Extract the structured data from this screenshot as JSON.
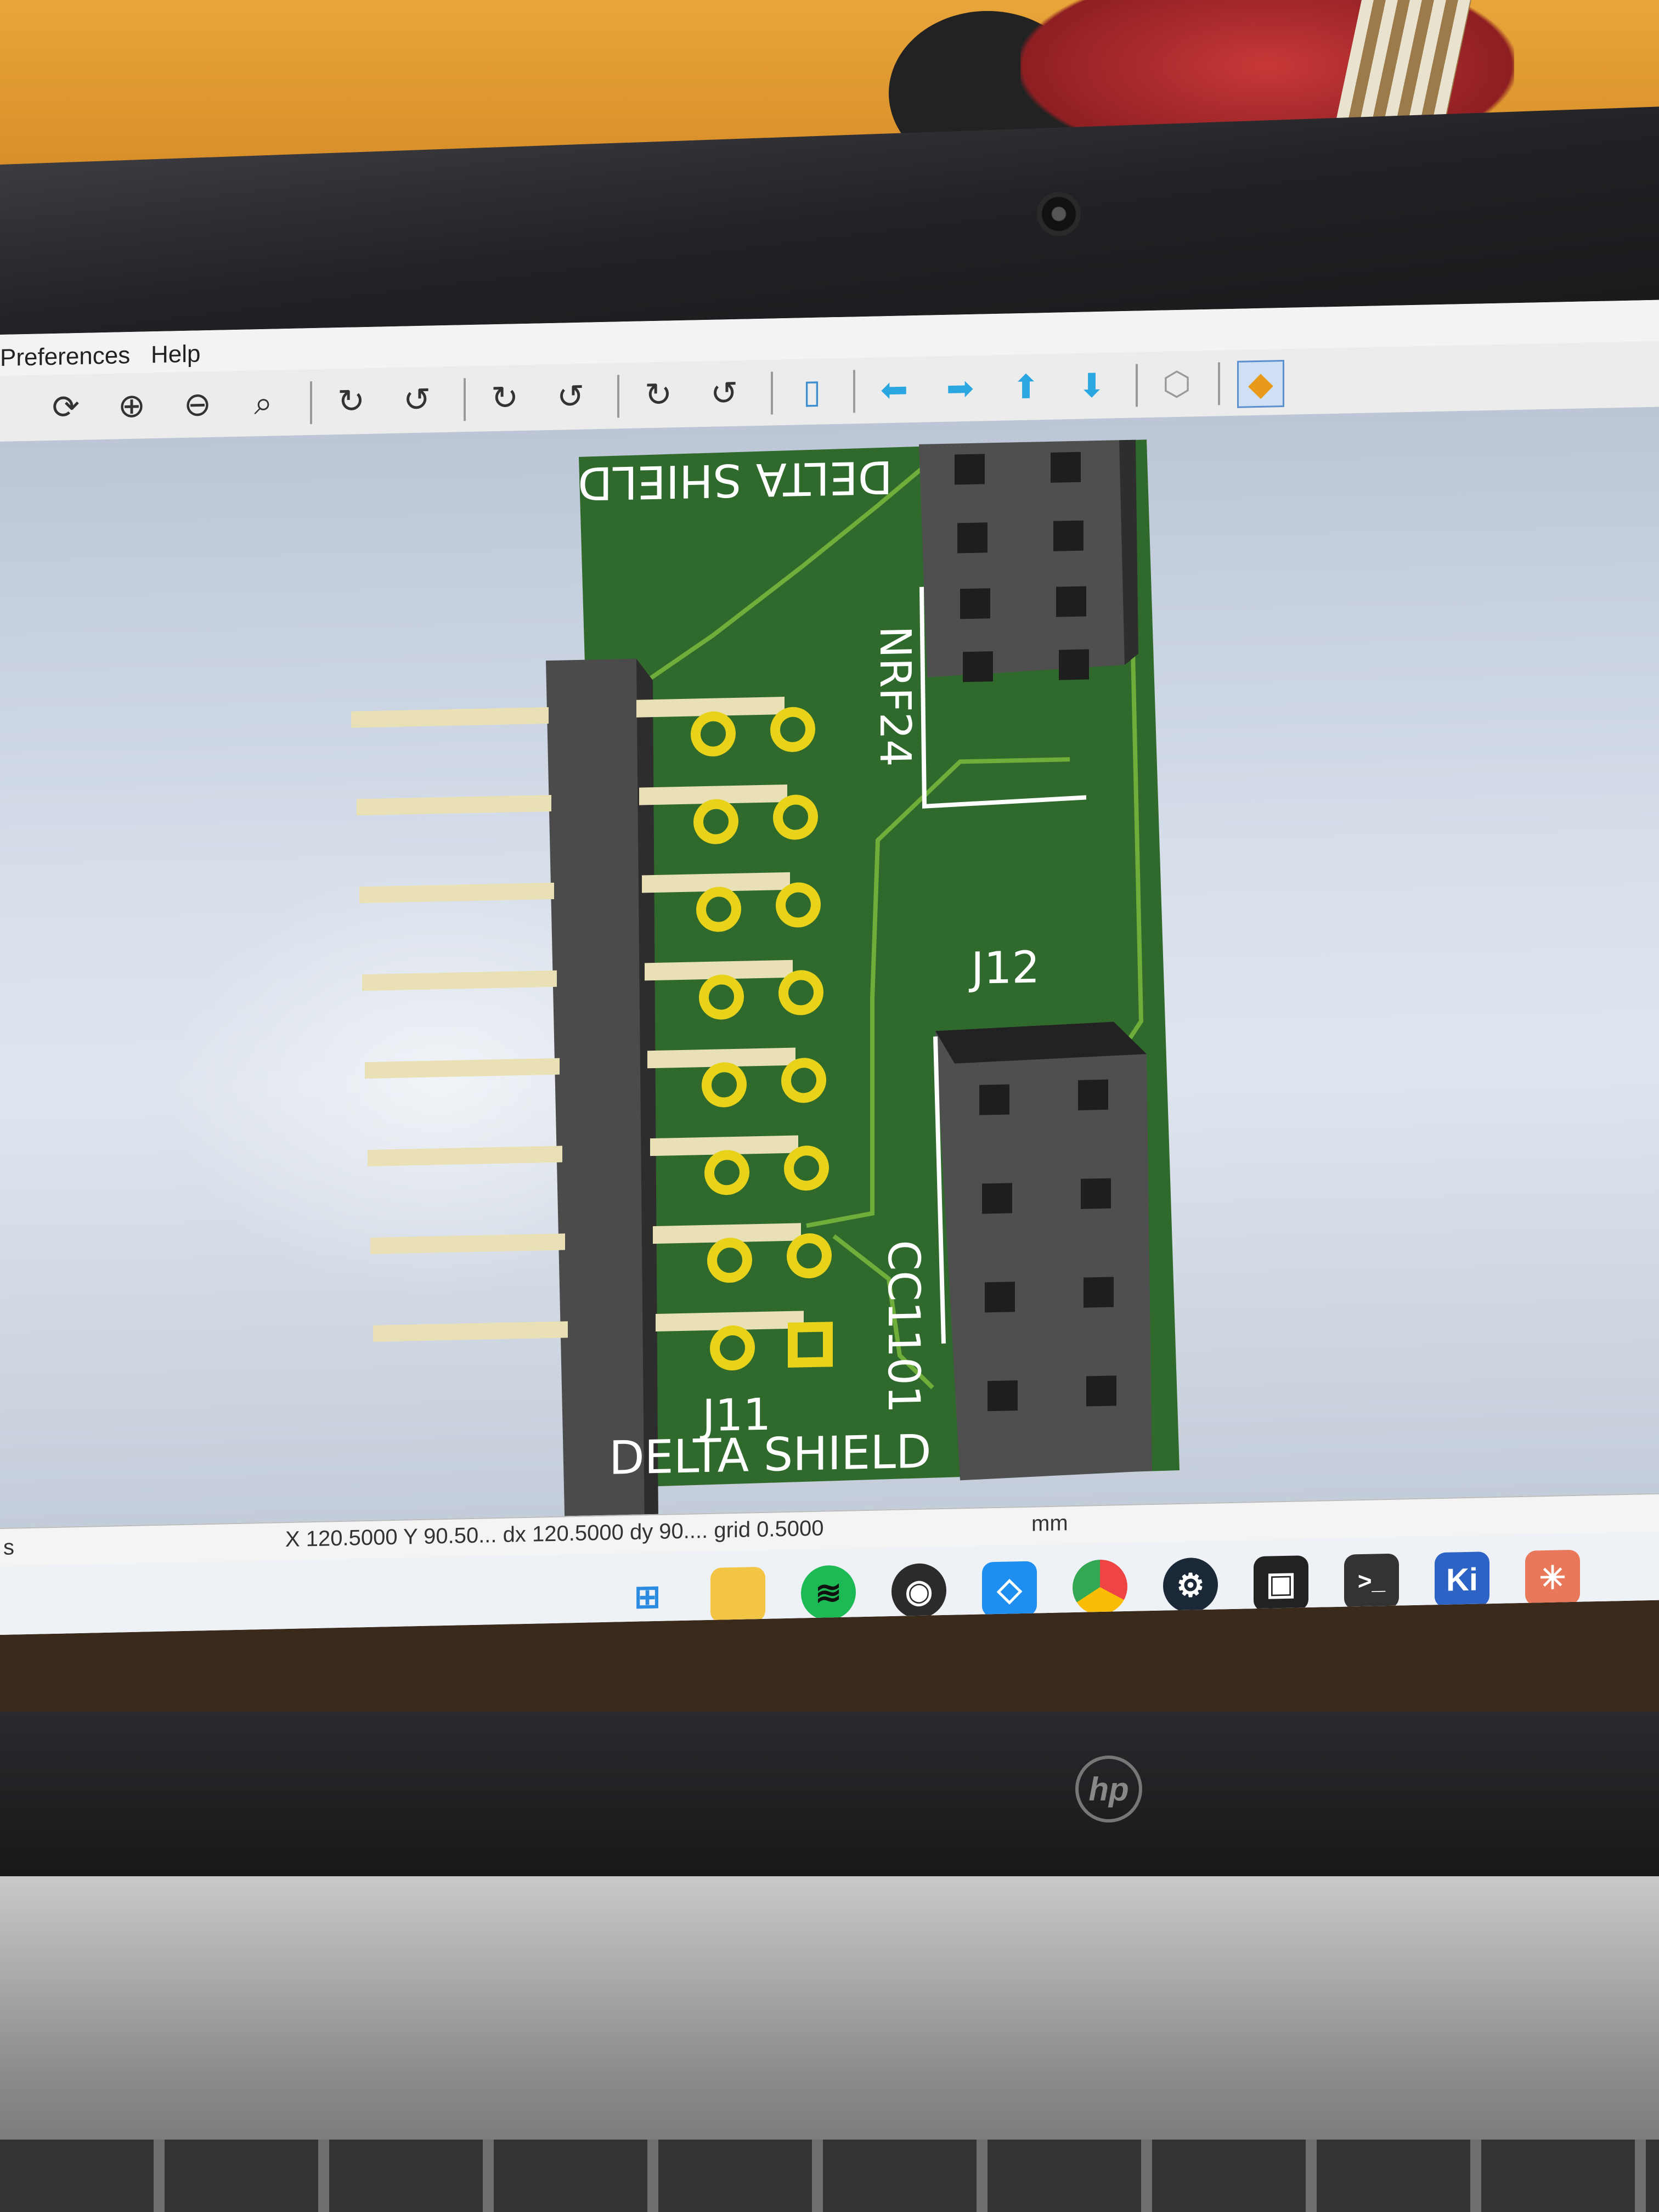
{
  "menu": {
    "items": [
      "Preferences",
      "Help"
    ]
  },
  "toolbar": {
    "buttons": [
      {
        "icon": "refresh-icon"
      },
      {
        "icon": "zoom-in-icon"
      },
      {
        "icon": "zoom-out-icon"
      },
      {
        "icon": "zoom-fit-icon"
      },
      {
        "icon": "rotate-x-cw-icon"
      },
      {
        "icon": "rotate-x-ccw-icon"
      },
      {
        "icon": "rotate-y-cw-icon"
      },
      {
        "icon": "rotate-y-ccw-icon"
      },
      {
        "icon": "rotate-z-cw-icon"
      },
      {
        "icon": "rotate-z-ccw-icon"
      },
      {
        "icon": "flip-board-icon"
      },
      {
        "icon": "pan-left-icon"
      },
      {
        "icon": "pan-right-icon"
      },
      {
        "icon": "pan-up-icon"
      },
      {
        "icon": "pan-down-icon"
      },
      {
        "icon": "orthographic-icon"
      },
      {
        "icon": "layers-icon"
      }
    ]
  },
  "board": {
    "title_top": "DELTA SHIELD",
    "title_bottom": "DELTA SHIELD",
    "labels": {
      "nrf24": "NRF24",
      "j12": "J12",
      "j11": "J11",
      "cc1101": "CC1101"
    },
    "colors": {
      "soldermask": "#2f6a2c",
      "trace": "#6fae3a",
      "header_body": "#4b4b4b",
      "pin_gold": "#e9e1b5",
      "pad_yellow": "#e8d21a",
      "silkscreen": "#ffffff"
    }
  },
  "statusbar": {
    "left": "s",
    "coords": "X 120.5000  Y 90.50...  dx 120.5000  dy 90....  grid 0.5000",
    "units": "mm"
  },
  "taskbar": {
    "icons": [
      "windows-start-icon",
      "file-explorer-icon",
      "spotify-icon",
      "obs-icon",
      "roblox-icon",
      "chrome-icon",
      "steam-icon",
      "epic-icon",
      "terminal-icon",
      "kicad-icon",
      "claude-icon"
    ],
    "kicad_label": "Ki"
  },
  "laptop": {
    "brand": "hp"
  }
}
